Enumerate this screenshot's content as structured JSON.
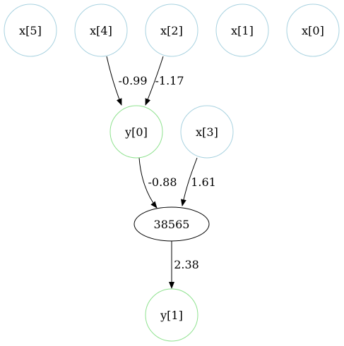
{
  "colors": {
    "input_node": "#a8d2e0",
    "output_node": "#8fe28f",
    "op_node": "#000000",
    "edge": "#000000"
  },
  "nodes": [
    {
      "id": "x5",
      "label": "x[5]",
      "kind": "input"
    },
    {
      "id": "x4",
      "label": "x[4]",
      "kind": "input"
    },
    {
      "id": "x2",
      "label": "x[2]",
      "kind": "input"
    },
    {
      "id": "x1",
      "label": "x[1]",
      "kind": "input"
    },
    {
      "id": "x0",
      "label": "x[0]",
      "kind": "input"
    },
    {
      "id": "y0",
      "label": "y[0]",
      "kind": "output"
    },
    {
      "id": "x3",
      "label": "x[3]",
      "kind": "input"
    },
    {
      "id": "op",
      "label": "38565",
      "kind": "op"
    },
    {
      "id": "y1",
      "label": "y[1]",
      "kind": "output"
    }
  ],
  "edges": [
    {
      "from": "x4",
      "to": "y0",
      "label": "-0.99"
    },
    {
      "from": "x2",
      "to": "y0",
      "label": "-1.17"
    },
    {
      "from": "y0",
      "to": "op",
      "label": "-0.88"
    },
    {
      "from": "x3",
      "to": "op",
      "label": "1.61"
    },
    {
      "from": "op",
      "to": "y1",
      "label": "2.38"
    }
  ]
}
